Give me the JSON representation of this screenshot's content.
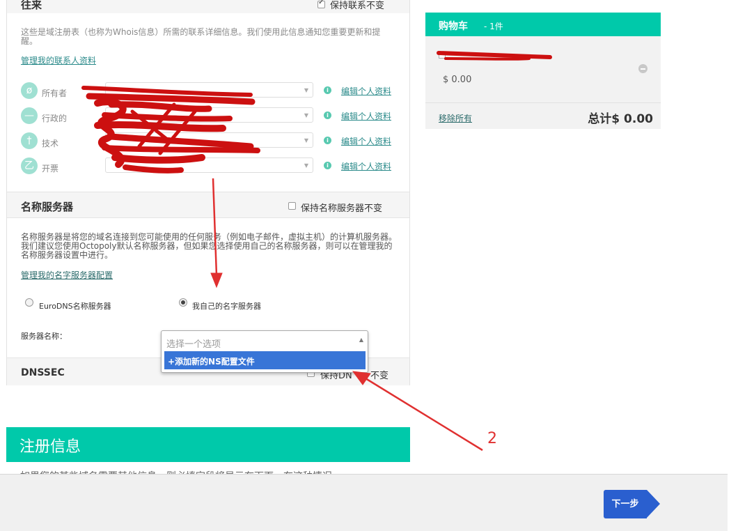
{
  "contacts": {
    "title": "往来",
    "keep_label": "保持联系不变",
    "intro": "这些是域注册表（也称为Whois信息）所需的联系详细信息。我们使用此信息通知您重要更新和提醒。",
    "manage_link": "管理我的联系人资料",
    "roles": [
      {
        "label": "所有者",
        "glyph": "ø",
        "edit": "编辑个人资料"
      },
      {
        "label": "行政的",
        "glyph": "—",
        "edit": "编辑个人资料"
      },
      {
        "label": "技术",
        "glyph": "†",
        "edit": "编辑个人资料"
      },
      {
        "label": "开票",
        "glyph": "乙",
        "edit": "编辑个人资料"
      }
    ],
    "info_glyph": "i"
  },
  "nameservers": {
    "title": "名称服务器",
    "keep_label": "保持名称服务器不变",
    "description": "名称服务器是将您的域名连接到您可能使用的任何服务（例如电子邮件，虚拟主机）的计算机服务器。我们建议您使用Octopoly默认名称服务器，但如果您选择使用自己的名称服务器，则可以在管理我的名称服务器设置中进行。",
    "manage_link": "管理我的名字服务器配置",
    "option_eurodns": "EuroDNS名称服务器",
    "option_own": "我自己的名字服务器",
    "server_name_label": "服务器名称：",
    "select_placeholder": "选择一个选项",
    "select_option": "+添加新的NS配置文件"
  },
  "dnssec": {
    "title": "DNSSEC",
    "keep_label_visible": "保持DN",
    "keep_label_tail": "不变"
  },
  "cart": {
    "title": "购物车",
    "count": "- 1件",
    "price": "$ 0.00",
    "remove_all": "移除所有",
    "total": "总计$ 0.00"
  },
  "registration": {
    "title": "注册信息",
    "text": "如果您的某些域名需要其他信息，则必填字段将显示在下面。在这种情况"
  },
  "footer": {
    "next_label": "下一步"
  },
  "annotation": {
    "number": "2"
  },
  "colors": {
    "accent": "#00c9aa",
    "button": "#2a5fcf",
    "annotation": "#e03030",
    "scribble": "#cc1010"
  }
}
